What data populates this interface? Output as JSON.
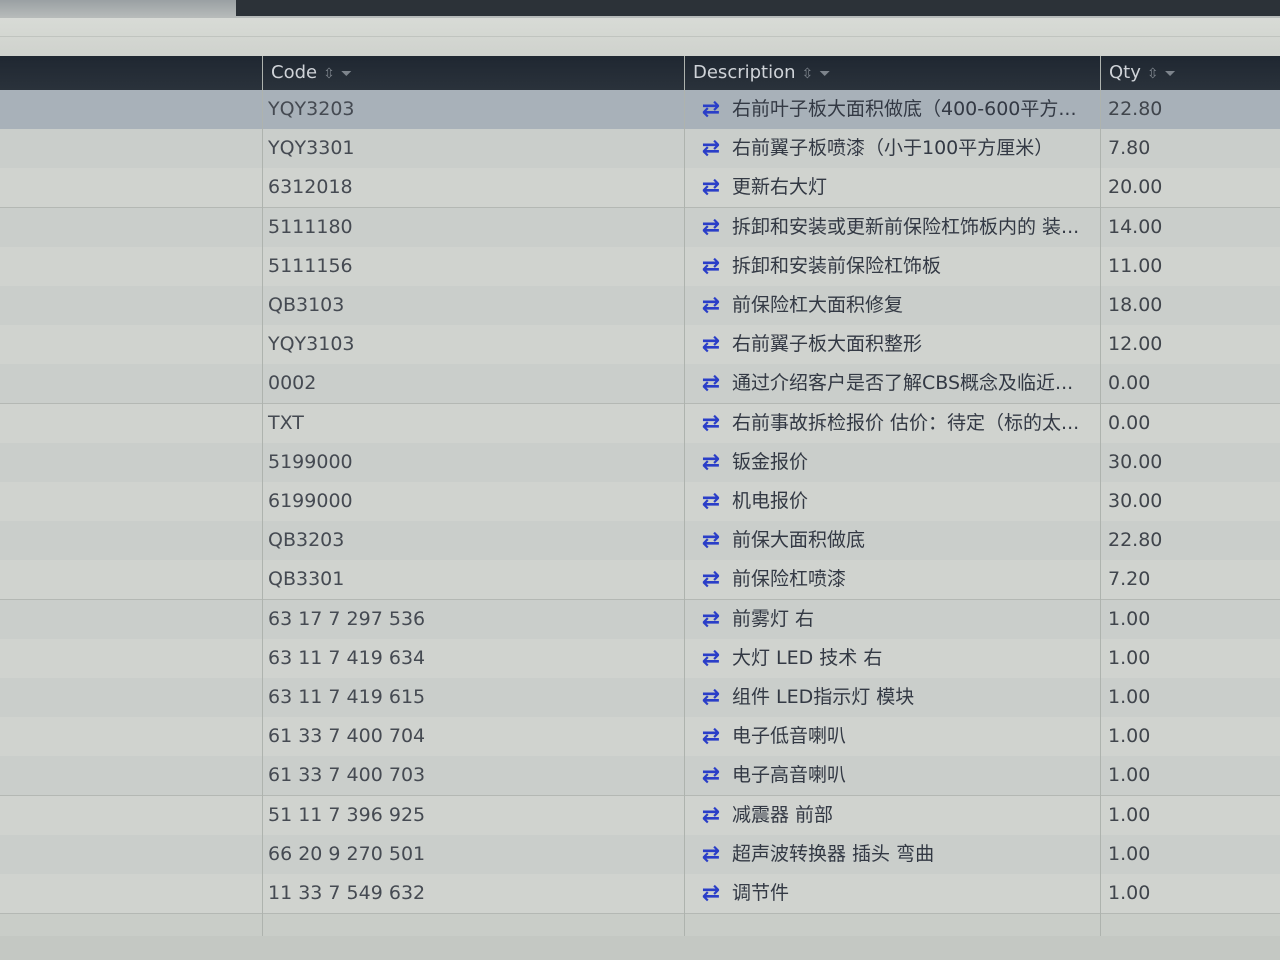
{
  "columns": {
    "code": "Code",
    "description": "Description",
    "qty": "Qty"
  },
  "rows": [
    {
      "code": "YQY3203",
      "description": "右前叶子板大面积做底（400-600平方...",
      "qty": "22.80"
    },
    {
      "code": "YQY3301",
      "description": "右前翼子板喷漆（小于100平方厘米）",
      "qty": "7.80"
    },
    {
      "code": "6312018",
      "description": "更新右大灯",
      "qty": "20.00"
    },
    {
      "code": "5111180",
      "description": "拆卸和安装或更新前保险杠饰板内的 装...",
      "qty": "14.00"
    },
    {
      "code": "5111156",
      "description": "拆卸和安装前保险杠饰板",
      "qty": "11.00"
    },
    {
      "code": "QB3103",
      "description": "前保险杠大面积修复",
      "qty": "18.00"
    },
    {
      "code": "YQY3103",
      "description": "右前翼子板大面积整形",
      "qty": "12.00"
    },
    {
      "code": "0002",
      "description": "通过介绍客户是否了解CBS概念及临近...",
      "qty": "0.00"
    },
    {
      "code": "TXT",
      "description": "右前事故拆检报价 估价：待定（标的太...",
      "qty": "0.00"
    },
    {
      "code": "5199000",
      "description": "钣金报价",
      "qty": "30.00"
    },
    {
      "code": "6199000",
      "description": "机电报价",
      "qty": "30.00"
    },
    {
      "code": "QB3203",
      "description": "前保大面积做底",
      "qty": "22.80"
    },
    {
      "code": "QB3301",
      "description": "前保险杠喷漆",
      "qty": "7.20"
    },
    {
      "code": "63 17 7 297 536",
      "description": "前雾灯 右",
      "qty": "1.00"
    },
    {
      "code": "63 11 7 419 634",
      "description": "大灯 LED 技术 右",
      "qty": "1.00"
    },
    {
      "code": "63 11 7 419 615",
      "description": "组件 LED指示灯 模块",
      "qty": "1.00"
    },
    {
      "code": "61 33 7 400 704",
      "description": "电子低音喇叭",
      "qty": "1.00"
    },
    {
      "code": "61 33 7 400 703",
      "description": "电子高音喇叭",
      "qty": "1.00"
    },
    {
      "code": "51 11 7 396 925",
      "description": "减震器 前部",
      "qty": "1.00"
    },
    {
      "code": "66 20 9 270 501",
      "description": "超声波转换器 插头 弯曲",
      "qty": "1.00"
    },
    {
      "code": "11 33 7 549 632",
      "description": "调节件",
      "qty": "1.00"
    }
  ],
  "icons": {
    "sort": "sort-icon",
    "filter": "filter-icon",
    "row": "swap-arrows-icon"
  },
  "colors": {
    "header_bg": "#1f2731",
    "selected_row": "#a8b1b9",
    "swap_icon": "#2a3ec8"
  }
}
